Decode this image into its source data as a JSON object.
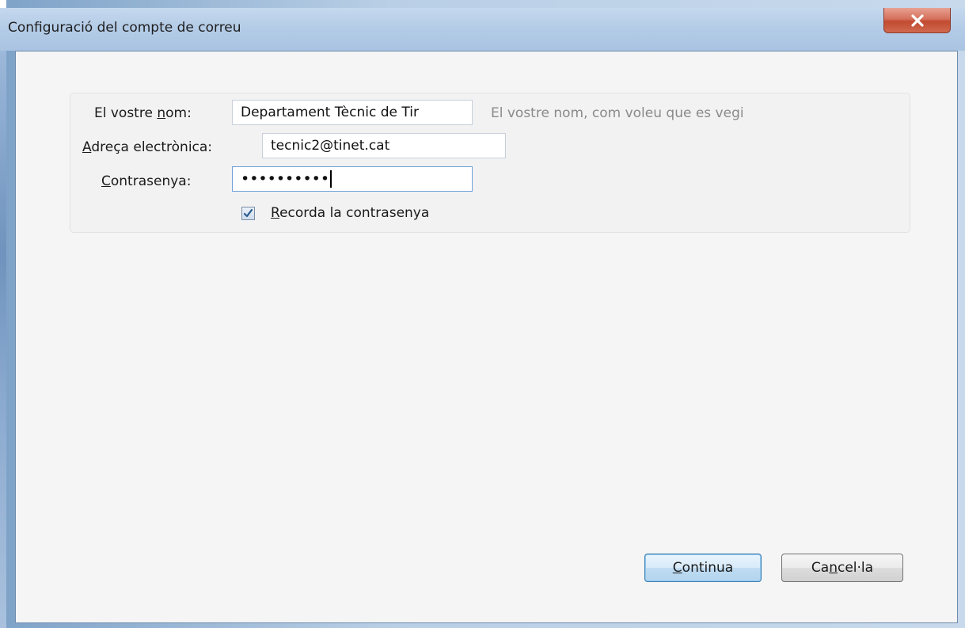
{
  "window": {
    "title": "Configuració del compte de correu",
    "close_glyph": "✕"
  },
  "form": {
    "name_label_pre": "El vostre ",
    "name_label_key": "n",
    "name_label_post": "om:",
    "name_value": "Departament Tècnic de Tir",
    "name_hint": "El vostre nom, com voleu que es vegi",
    "email_label_key": "A",
    "email_label_post": "dreça electrònica:",
    "email_value": "tecnic2@tinet.cat",
    "password_label_key": "C",
    "password_label_post": "ontrasenya:",
    "password_mask": "••••••••••",
    "remember_checked": true,
    "remember_label_key": "R",
    "remember_label_post": "ecorda la contrasenya"
  },
  "buttons": {
    "continue_key": "C",
    "continue_post": "ontinua",
    "cancel_pre": "Ca",
    "cancel_key": "n",
    "cancel_post": "cel·la"
  },
  "icons": {
    "close": "close-icon",
    "check": "checkmark-icon"
  },
  "colors": {
    "titlebar": "#b3cbe6",
    "close_button": "#c24a31",
    "default_button_border": "#3c7fb1",
    "hint_text": "#8a8a8a"
  }
}
